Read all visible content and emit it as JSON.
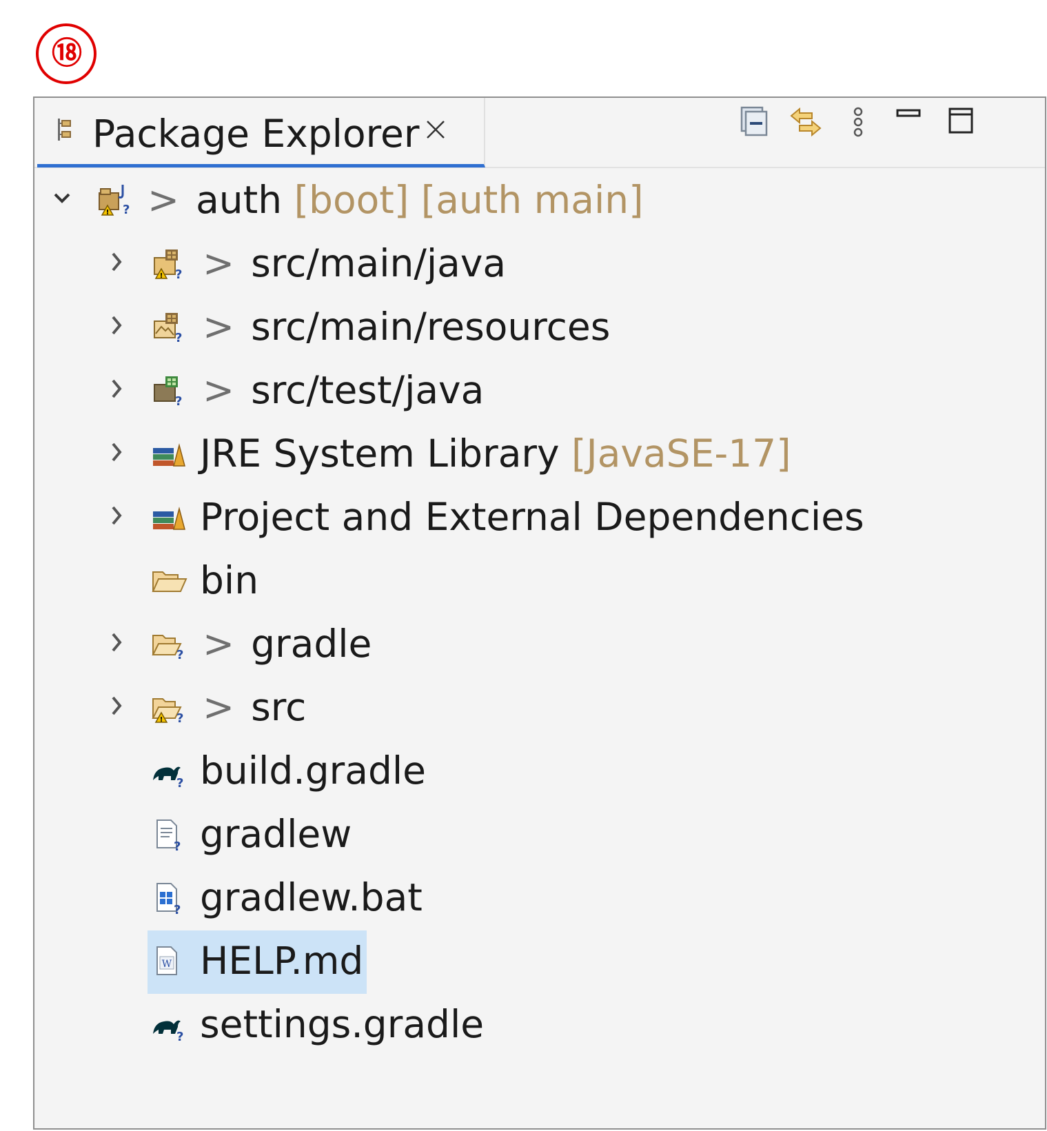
{
  "step_badge": "⑱",
  "panel": {
    "tab_title": "Package Explorer",
    "tab_icon": "package-explorer-icon",
    "close_icon": "close-icon",
    "toolbar": [
      {
        "name": "collapse-all-icon"
      },
      {
        "name": "link-with-editor-icon"
      },
      {
        "name": "view-menu-icon"
      },
      {
        "name": "minimize-icon"
      },
      {
        "name": "maximize-icon"
      }
    ]
  },
  "tree": {
    "project": {
      "dirty_marker": ">",
      "label": "auth",
      "decoration": "[boot] [auth main]",
      "icon": "java-project-icon",
      "expanded": true
    },
    "nodes": [
      {
        "dirty": ">",
        "label": "src/main/java",
        "decoration": "",
        "icon": "source-folder-icon",
        "twisty": true
      },
      {
        "dirty": ">",
        "label": "src/main/resources",
        "decoration": "",
        "icon": "source-folder-icon",
        "twisty": true
      },
      {
        "dirty": ">",
        "label": "src/test/java",
        "decoration": "",
        "icon": "source-folder-icon",
        "twisty": true
      },
      {
        "dirty": "",
        "label": "JRE System Library",
        "decoration": "[JavaSE-17]",
        "icon": "library-icon",
        "twisty": true
      },
      {
        "dirty": "",
        "label": "Project and External Dependencies",
        "decoration": "",
        "icon": "library-icon",
        "twisty": true
      },
      {
        "dirty": "",
        "label": "bin",
        "decoration": "",
        "icon": "folder-icon",
        "twisty": false
      },
      {
        "dirty": ">",
        "label": "gradle",
        "decoration": "",
        "icon": "folder-icon",
        "twisty": true
      },
      {
        "dirty": ">",
        "label": "src",
        "decoration": "",
        "icon": "folder-icon",
        "twisty": true
      },
      {
        "dirty": "",
        "label": "build.gradle",
        "decoration": "",
        "icon": "gradle-file-icon",
        "twisty": false
      },
      {
        "dirty": "",
        "label": "gradlew",
        "decoration": "",
        "icon": "text-file-icon",
        "twisty": false
      },
      {
        "dirty": "",
        "label": "gradlew.bat",
        "decoration": "",
        "icon": "batch-file-icon",
        "twisty": false
      },
      {
        "dirty": "",
        "label": "HELP.md",
        "decoration": "",
        "icon": "markdown-file-icon",
        "twisty": false,
        "selected": true
      },
      {
        "dirty": "",
        "label": "settings.gradle",
        "decoration": "",
        "icon": "gradle-file-icon",
        "twisty": false
      }
    ]
  },
  "colors": {
    "badge": "#e00000",
    "tab_underline": "#2f6fd1",
    "selection": "#cce3f7",
    "decoration_text": "#b29464"
  }
}
